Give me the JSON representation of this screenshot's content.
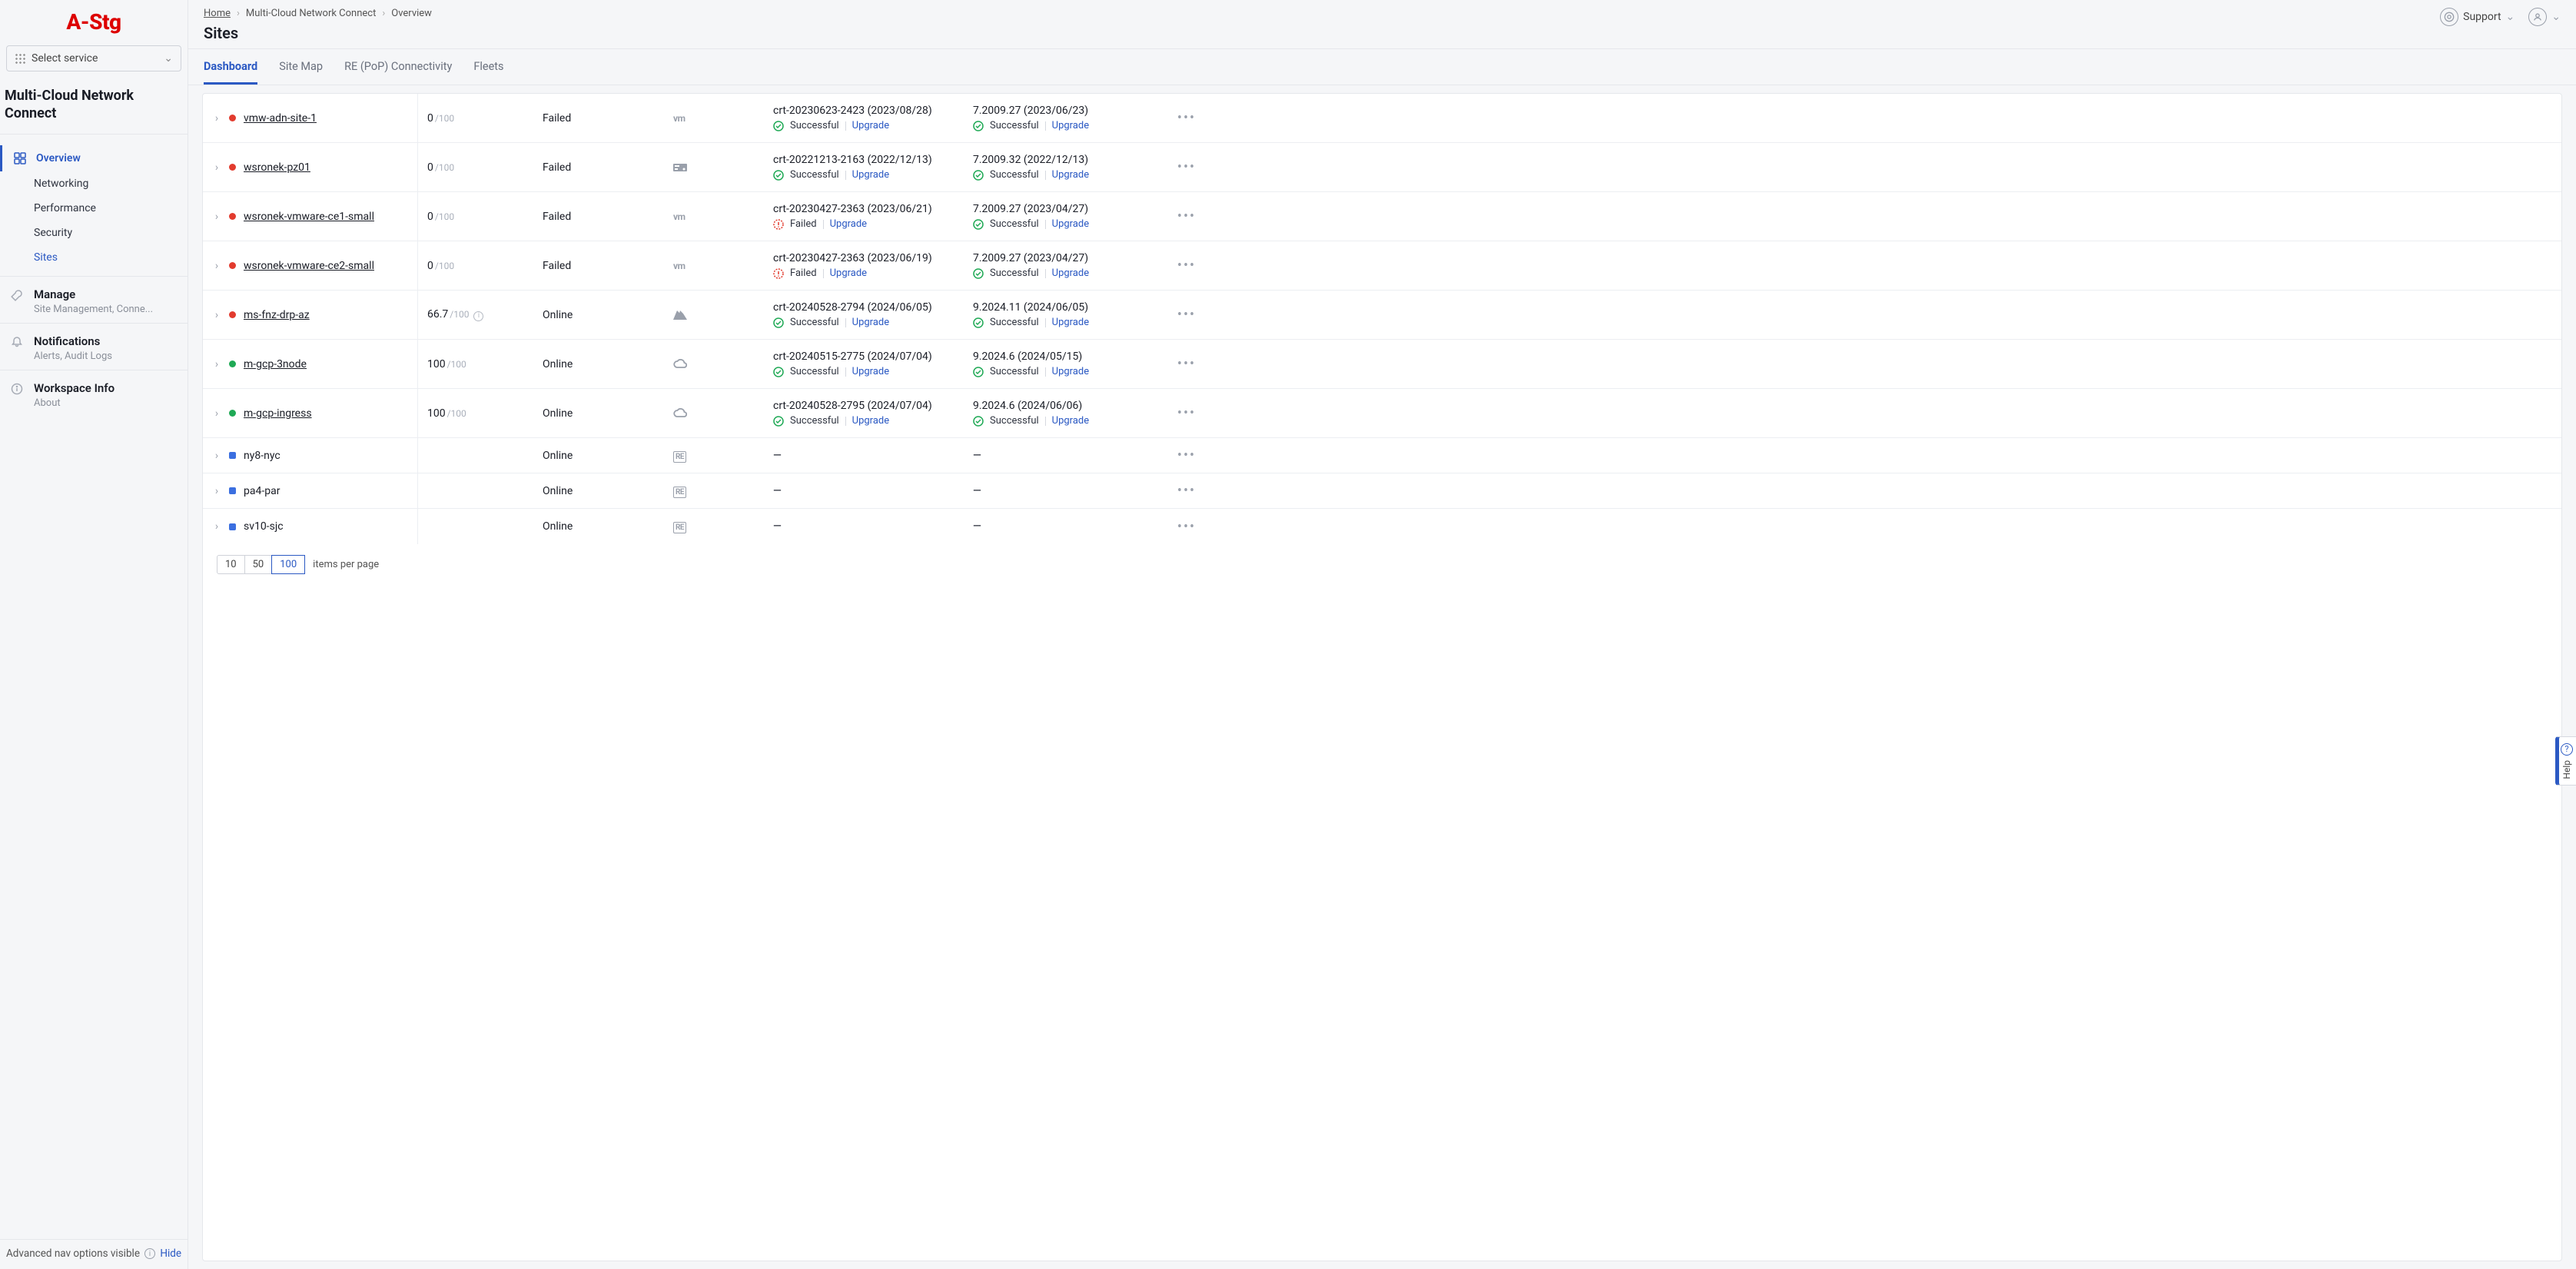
{
  "logo": "A-Stg",
  "service_select_label": "Select service",
  "section_title": "Multi-Cloud Network Connect",
  "sidebar": {
    "overview": "Overview",
    "networking": "Networking",
    "performance": "Performance",
    "security": "Security",
    "sites": "Sites",
    "manage": {
      "title": "Manage",
      "sub": "Site Management, Conne..."
    },
    "notifications": {
      "title": "Notifications",
      "sub": "Alerts, Audit Logs"
    },
    "workspace": {
      "title": "Workspace Info",
      "sub": "About"
    },
    "footer_text": "Advanced nav options visible",
    "hide": "Hide"
  },
  "breadcrumbs": {
    "home": "Home",
    "l1": "Multi-Cloud Network Connect",
    "l2": "Overview"
  },
  "page_title": "Sites",
  "topbar": {
    "support": "Support"
  },
  "tabs": {
    "dashboard": "Dashboard",
    "sitemap": "Site Map",
    "repop": "RE (PoP) Connectivity",
    "fleets": "Fleets"
  },
  "labels": {
    "success": "Successful",
    "failed": "Failed",
    "upgrade": "Upgrade",
    "per100": "/100",
    "items_per_page": "items per page",
    "dash": "—",
    "online": "Online",
    "failed_state": "Failed"
  },
  "pager": {
    "opt10": "10",
    "opt50": "50",
    "opt100": "100"
  },
  "help": "Help",
  "rows": [
    {
      "name": "vmw-adn-site-1",
      "dot": "red",
      "link": true,
      "slim": false,
      "score": "0",
      "denom": true,
      "info": false,
      "state": "Failed",
      "provider": "vmw",
      "sw": {
        "ver": "crt-20230623-2423 (2023/08/28)",
        "status": "ok",
        "status_txt": "Successful"
      },
      "os": {
        "ver": "7.2009.27 (2023/06/23)",
        "status": "ok",
        "status_txt": "Successful"
      }
    },
    {
      "name": "wsronek-pz01",
      "dot": "red",
      "link": true,
      "slim": false,
      "score": "0",
      "denom": true,
      "info": false,
      "state": "Failed",
      "provider": "kvm",
      "sw": {
        "ver": "crt-20221213-2163 (2022/12/13)",
        "status": "ok",
        "status_txt": "Successful"
      },
      "os": {
        "ver": "7.2009.32 (2022/12/13)",
        "status": "ok",
        "status_txt": "Successful"
      }
    },
    {
      "name": "wsronek-vmware-ce1-small",
      "dot": "red",
      "link": true,
      "slim": false,
      "score": "0",
      "denom": true,
      "info": false,
      "state": "Failed",
      "provider": "vmw",
      "sw": {
        "ver": "crt-20230427-2363 (2023/06/21)",
        "status": "fail",
        "status_txt": "Failed"
      },
      "os": {
        "ver": "7.2009.27 (2023/04/27)",
        "status": "ok",
        "status_txt": "Successful"
      }
    },
    {
      "name": "wsronek-vmware-ce2-small",
      "dot": "red",
      "link": true,
      "slim": false,
      "score": "0",
      "denom": true,
      "info": false,
      "state": "Failed",
      "provider": "vmw",
      "sw": {
        "ver": "crt-20230427-2363 (2023/06/19)",
        "status": "fail",
        "status_txt": "Failed"
      },
      "os": {
        "ver": "7.2009.27 (2023/04/27)",
        "status": "ok",
        "status_txt": "Successful"
      }
    },
    {
      "name": "ms-fnz-drp-az",
      "dot": "red",
      "link": true,
      "slim": false,
      "score": "66.7",
      "denom": true,
      "info": true,
      "state": "Online",
      "provider": "azure",
      "sw": {
        "ver": "crt-20240528-2794 (2024/06/05)",
        "status": "ok",
        "status_txt": "Successful"
      },
      "os": {
        "ver": "9.2024.11 (2024/06/05)",
        "status": "ok",
        "status_txt": "Successful"
      }
    },
    {
      "name": "m-gcp-3node",
      "dot": "green",
      "link": true,
      "slim": false,
      "score": "100",
      "denom": true,
      "info": false,
      "state": "Online",
      "provider": "gcp",
      "sw": {
        "ver": "crt-20240515-2775 (2024/07/04)",
        "status": "ok",
        "status_txt": "Successful"
      },
      "os": {
        "ver": "9.2024.6 (2024/05/15)",
        "status": "ok",
        "status_txt": "Successful"
      }
    },
    {
      "name": "m-gcp-ingress",
      "dot": "green",
      "link": true,
      "slim": false,
      "score": "100",
      "denom": true,
      "info": false,
      "state": "Online",
      "provider": "gcp",
      "sw": {
        "ver": "crt-20240528-2795 (2024/07/04)",
        "status": "ok",
        "status_txt": "Successful"
      },
      "os": {
        "ver": "9.2024.6 (2024/06/06)",
        "status": "ok",
        "status_txt": "Successful"
      }
    },
    {
      "name": "ny8-nyc",
      "dot": "blue",
      "link": false,
      "slim": true,
      "score": "",
      "denom": false,
      "info": false,
      "state": "Online",
      "provider": "re",
      "sw": null,
      "os": null
    },
    {
      "name": "pa4-par",
      "dot": "blue",
      "link": false,
      "slim": true,
      "score": "",
      "denom": false,
      "info": false,
      "state": "Online",
      "provider": "re",
      "sw": null,
      "os": null
    },
    {
      "name": "sv10-sjc",
      "dot": "blue",
      "link": false,
      "slim": true,
      "score": "",
      "denom": false,
      "info": false,
      "state": "Online",
      "provider": "re",
      "sw": null,
      "os": null
    }
  ]
}
